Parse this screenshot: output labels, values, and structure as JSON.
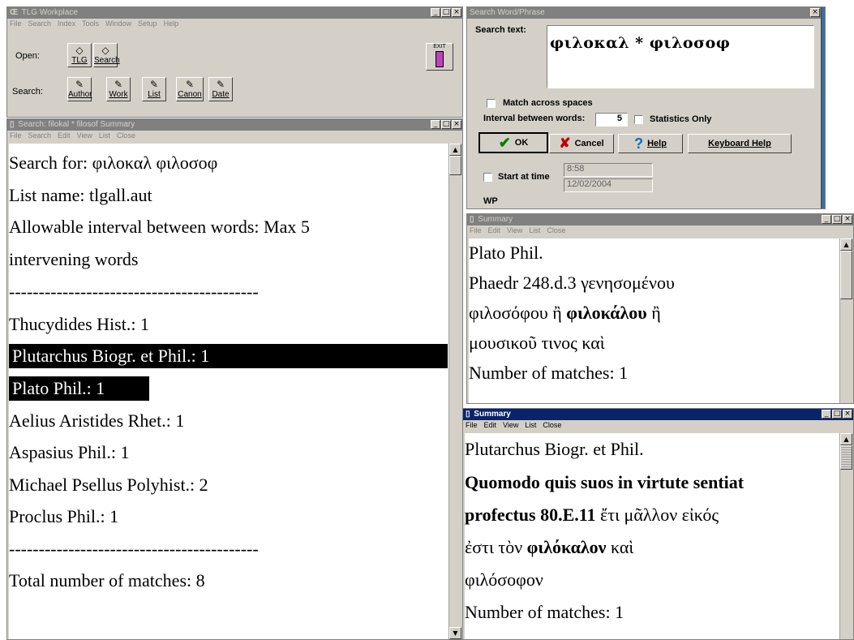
{
  "workplace": {
    "title": "TLG Workplace",
    "menu": [
      "File",
      "Search",
      "Index",
      "Tools",
      "Window",
      "Setup",
      "Help"
    ],
    "open_label": "Open:",
    "search_label": "Search:",
    "open_buttons": [
      {
        "label": "TLG"
      },
      {
        "label": "Search"
      }
    ],
    "search_buttons": [
      {
        "label": "Author"
      },
      {
        "label": "Work"
      },
      {
        "label": "List"
      },
      {
        "label": "Canon"
      },
      {
        "label": "Date"
      }
    ],
    "exit_label": "EXIT"
  },
  "search_summary": {
    "title": "Search: filokal * filosof Summary",
    "menu": [
      "File",
      "Search",
      "Edit",
      "View",
      "List",
      "Close"
    ],
    "lines": [
      "Search for:  φιλοκαλ  φιλοσοφ",
      "List name:  tlgall.aut",
      "Allowable interval between words: Max 5",
      "intervening words",
      "------------------------------------------",
      " Thucydides Hist.: 1",
      " Plutarchus Biogr. et Phil.: 1",
      " Plato Phil.: 1",
      " Aelius Aristides Rhet.: 1",
      " Aspasius Phil.: 1",
      " Michael Psellus Polyhist.: 2",
      " Proclus Phil.: 1",
      "------------------------------------------",
      "Total number of matches:  8"
    ]
  },
  "search_dialog": {
    "title": "Search Word/Phrase",
    "search_text_label": "Search text:",
    "search_text_value": "φιλοκαλ * φιλοσοφ",
    "match_across_label": "Match across spaces",
    "interval_label": "Interval between words:",
    "interval_value": "5",
    "stats_only_label": "Statistics Only",
    "ok_label": "OK",
    "cancel_label": "Cancel",
    "help_label": "Help",
    "keyboard_help_label": "Keyboard Help",
    "start_at_time_label": "Start at time",
    "time_value": "8:58",
    "date_value": "12/02/2004",
    "wp_label": "WP"
  },
  "summary_plato": {
    "title": "Summary",
    "menu": [
      "File",
      "Edit",
      "View",
      "List",
      "Close"
    ],
    "lines": [
      [
        {
          "t": " Plato Phil."
        }
      ],
      [
        {
          "t": "Phaedr 248.d.3 γενησομένου"
        }
      ],
      [
        {
          "t": "φιλοσόφου ἢ "
        },
        {
          "t": "φιλοκάλου",
          "b": true
        },
        {
          "t": " ἢ"
        }
      ],
      [
        {
          "t": "μουσικοῦ τινος καὶ"
        }
      ],
      [
        {
          "t": "Number of matches:  1"
        }
      ]
    ]
  },
  "summary_plutarch": {
    "title": "Summary",
    "menu": [
      "File",
      "Edit",
      "View",
      "List",
      "Close"
    ],
    "lines": [
      [
        {
          "t": " Plutarchus Biogr. et Phil."
        }
      ],
      [
        {
          "t": "Quomodo quis suos in virtute sentiat",
          "b": true
        }
      ],
      [
        {
          "t": "profectus  80.E.11",
          "b": true
        },
        {
          "t": " ἔτι μᾶλλον εἰκός"
        }
      ],
      [
        {
          "t": "ἐστι τὸν "
        },
        {
          "t": "φιλόκαλον",
          "b": true
        },
        {
          "t": "  καὶ"
        }
      ],
      [
        {
          "t": "φιλόσοφον"
        }
      ],
      [
        {
          "t": "Number of matches:  1"
        }
      ]
    ]
  },
  "colors": {
    "selection_bg": "#000000",
    "active_title": "#0a246a",
    "inactive_title": "#808080",
    "desktop": "#3a6ea5"
  }
}
